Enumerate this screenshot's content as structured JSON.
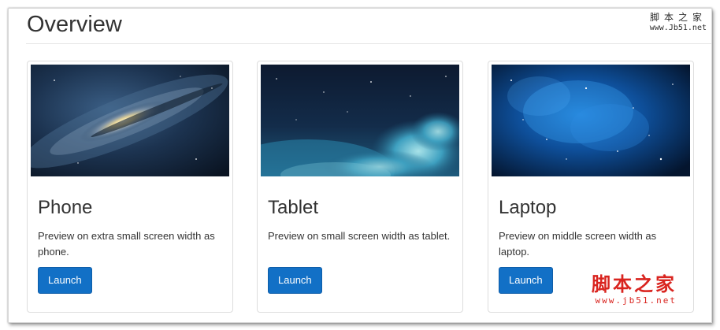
{
  "page": {
    "title": "Overview"
  },
  "cards": [
    {
      "title": "Phone",
      "description": "Preview on extra small screen width as phone.",
      "button_label": "Launch",
      "image": "galaxy-image"
    },
    {
      "title": "Tablet",
      "description": "Preview on small screen width as tablet.",
      "button_label": "Launch",
      "image": "nebula-clouds-image"
    },
    {
      "title": "Laptop",
      "description": "Preview on middle screen width as laptop.",
      "button_label": "Launch",
      "image": "blue-starfield-image"
    }
  ],
  "watermark": {
    "top_text": "脚本之家",
    "top_url": "www.Jb51.net",
    "bottom_text": "脚本之家",
    "bottom_url": "www.jb51.net"
  },
  "colors": {
    "button": "#1270c6",
    "text": "#333333",
    "border": "#dddddd",
    "watermark_red": "#d9241f"
  }
}
